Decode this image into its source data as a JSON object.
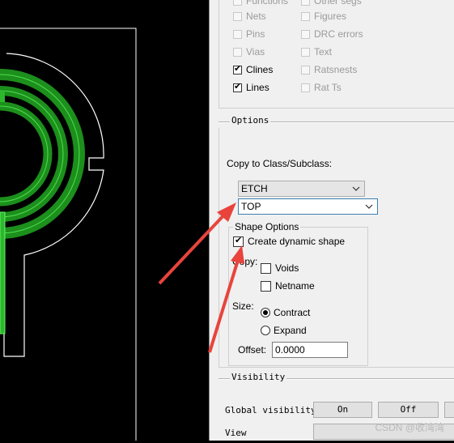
{
  "layers_list": {
    "col1": [
      {
        "label": "Functions",
        "checked": false,
        "enabled": false
      },
      {
        "label": "Nets",
        "checked": false,
        "enabled": false
      },
      {
        "label": "Pins",
        "checked": false,
        "enabled": false
      },
      {
        "label": "Vias",
        "checked": false,
        "enabled": false
      },
      {
        "label": "Clines",
        "checked": true,
        "enabled": true
      },
      {
        "label": "Lines",
        "checked": true,
        "enabled": true
      }
    ],
    "col2": [
      {
        "label": "Other segs",
        "checked": false,
        "enabled": false
      },
      {
        "label": "Figures",
        "checked": false,
        "enabled": false
      },
      {
        "label": "DRC errors",
        "checked": false,
        "enabled": false
      },
      {
        "label": "Text",
        "checked": false,
        "enabled": false
      },
      {
        "label": "Ratsnests",
        "checked": false,
        "enabled": false
      },
      {
        "label": "Rat Ts",
        "checked": false,
        "enabled": false
      }
    ]
  },
  "options": {
    "title": "Options",
    "copy_to_label": "Copy to Class/Subclass:",
    "class_value": "ETCH",
    "subclass_value": "TOP",
    "shape_options": {
      "title": "Shape Options",
      "create_dynamic_shape": {
        "label": "Create dynamic shape",
        "checked": true
      },
      "copy_label": "Copy:",
      "voids": {
        "label": "Voids",
        "checked": false
      },
      "netname": {
        "label": "Netname",
        "checked": false
      },
      "size_label": "Size:",
      "contract": {
        "label": "Contract",
        "selected": true
      },
      "expand": {
        "label": "Expand",
        "selected": false
      },
      "offset_label": "Offset:",
      "offset_value": "0.0000"
    }
  },
  "visibility": {
    "title": "Visibility",
    "global_label": "Global visibility",
    "on_label": "On",
    "off_label": "Off",
    "view_label": "View"
  },
  "watermark": "CSDN @收湾湾",
  "colors": {
    "canvas_bg": "#000000",
    "outline": "#ffffff",
    "trace_green": "#1fa01f",
    "trace_bright": "#39d939",
    "arrow_red": "#e8443c"
  }
}
